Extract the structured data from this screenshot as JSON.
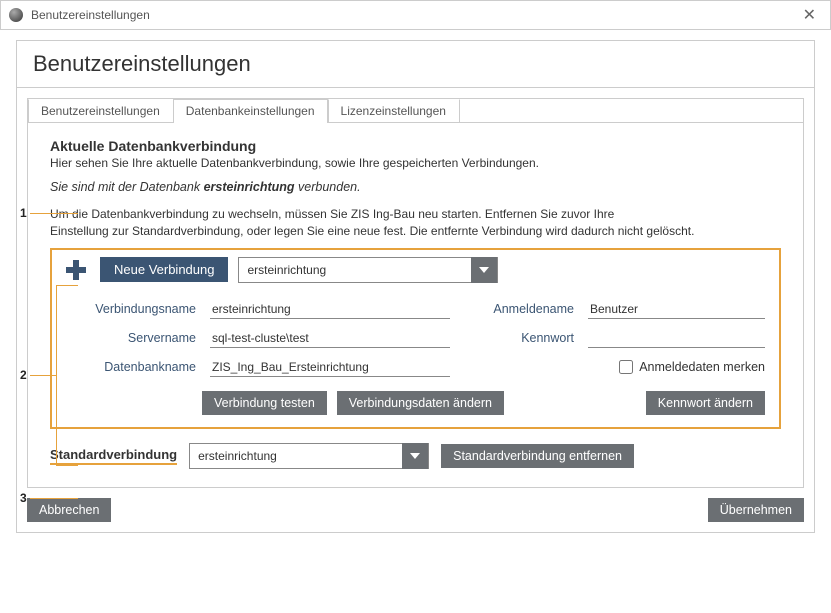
{
  "titlebar": {
    "text": "Benutzereinstellungen"
  },
  "header": {
    "title": "Benutzereinstellungen"
  },
  "tabs": {
    "t0": "Benutzereinstellungen",
    "t1": "Datenbankeinstellungen",
    "t2": "Lizenzeinstellungen"
  },
  "section": {
    "title": "Aktuelle Datenbankverbindung",
    "desc": "Hier sehen Sie Ihre aktuelle Datenbankverbindung, sowie Ihre gespeicherten Verbindungen.",
    "status_pre": "Sie sind mit der Datenbank ",
    "status_db": "ersteinrichtung",
    "status_post": " verbunden.",
    "help1": "Um die Datenbankverbindung zu wechseln, müssen Sie ZIS Ing-Bau neu starten. Entfernen Sie zuvor Ihre",
    "help2": "Einstellung zur Standardverbindung, oder legen Sie eine neue fest. Die entfernte Verbindung wird dadurch nicht gelöscht."
  },
  "connbox": {
    "new_label": "Neue Verbindung",
    "dd_selected": "ersteinrichtung",
    "labels": {
      "verbindungsname": "Verbindungsname",
      "servername": "Servername",
      "datenbankname": "Datenbankname",
      "anmeldename": "Anmeldename",
      "kennwort": "Kennwort",
      "remember": "Anmeldedaten merken"
    },
    "values": {
      "verbindungsname": "ersteinrichtung",
      "servername": "sql-test-cluste\\test",
      "datenbankname": "ZIS_Ing_Bau_Ersteinrichtung",
      "anmeldename": "Benutzer",
      "kennwort": ""
    },
    "buttons": {
      "test": "Verbindung testen",
      "edit": "Verbindungsdaten ändern",
      "pwd": "Kennwort ändern"
    }
  },
  "std": {
    "label": "Standardverbindung",
    "selected": "ersteinrichtung",
    "remove": "Standardverbindung entfernen"
  },
  "footer": {
    "cancel": "Abbrechen",
    "apply": "Übernehmen"
  },
  "callouts": {
    "c1": "1",
    "c2": "2",
    "c3": "3"
  }
}
